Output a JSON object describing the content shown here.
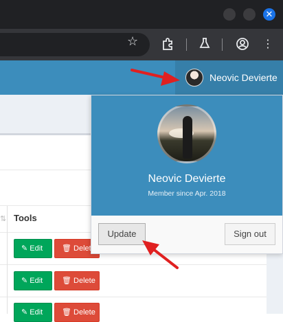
{
  "browser": {
    "star_icon": "star-icon",
    "close_symbol": "✕"
  },
  "header": {
    "user_name": "Neovic Devierte"
  },
  "user_dropdown": {
    "name": "Neovic Devierte",
    "member_since": "Member since Apr. 2018",
    "update_label": "Update",
    "signout_label": "Sign out"
  },
  "table": {
    "tools_header": "Tools",
    "rows": [
      {
        "edit_label": "Edit",
        "delete_label": "Delete"
      },
      {
        "edit_label": "Edit",
        "delete_label": "Delete"
      },
      {
        "edit_label": "Edit",
        "delete_label": "Delete"
      }
    ]
  },
  "colors": {
    "header": "#3c8dbc",
    "user_menu": "#367fa9",
    "edit": "#00a65a",
    "delete": "#dd4b39",
    "annotation": "#e02020"
  }
}
